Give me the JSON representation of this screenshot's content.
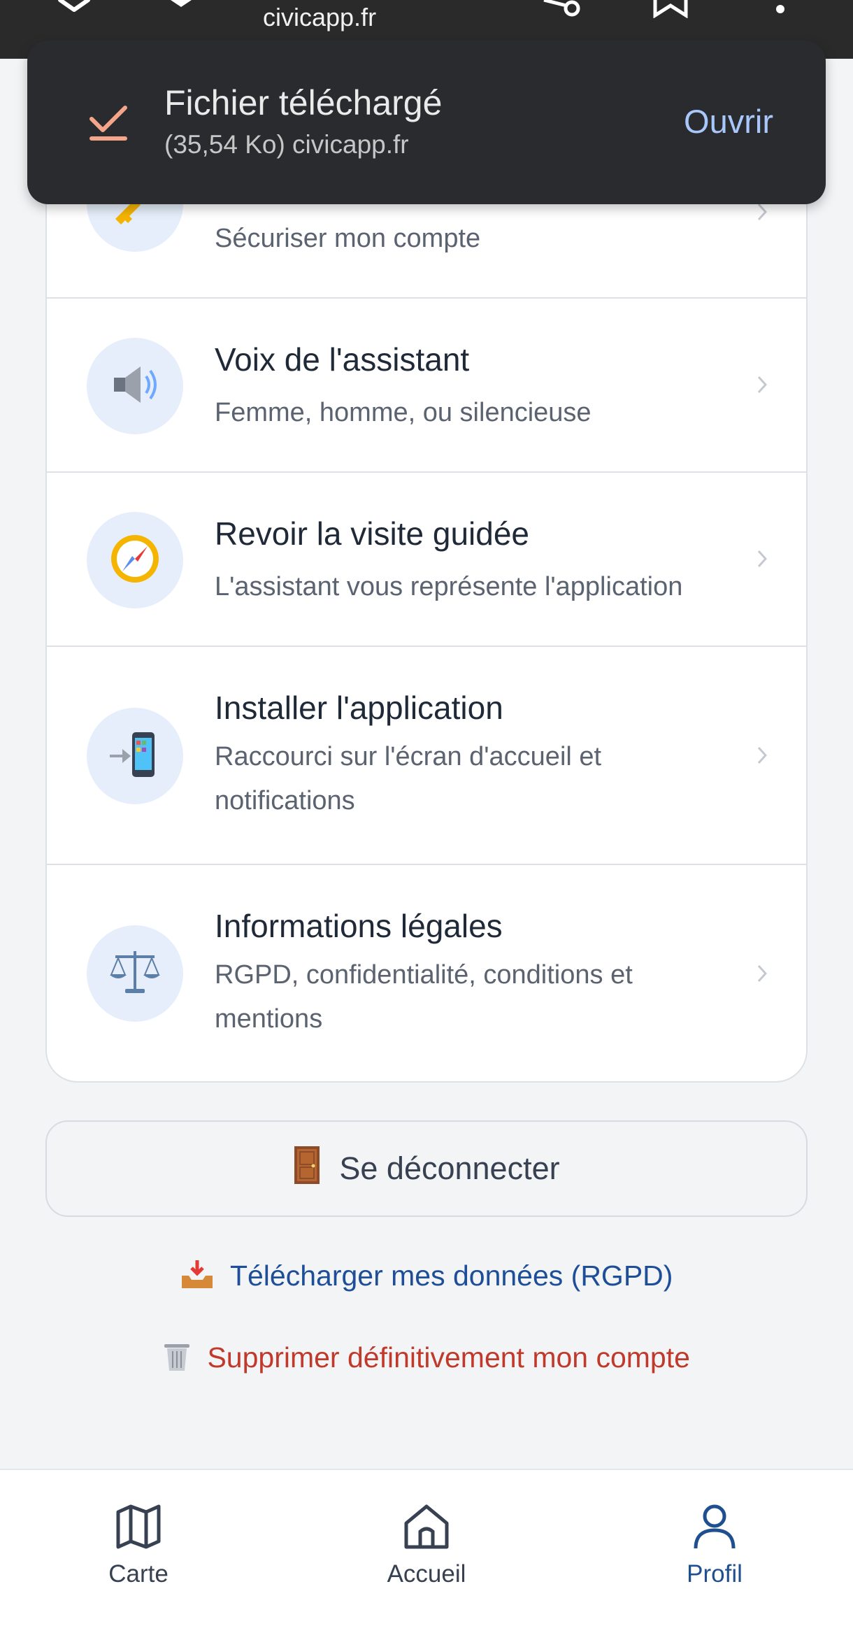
{
  "browser": {
    "url": "civicapp.fr",
    "icons": [
      "close-icon",
      "chevron-down-icon",
      "share-icon",
      "bookmark-icon",
      "more-vert-icon"
    ]
  },
  "toast": {
    "title": "Fichier téléchargé",
    "subtitle": "(35,54 Ko) civicapp.fr",
    "action": "Ouvrir",
    "icon": "download-done-icon"
  },
  "settings": {
    "items": [
      {
        "title": "",
        "subtitle": "Sécuriser mon compte",
        "icon": "key-icon"
      },
      {
        "title": "Voix de l'assistant",
        "subtitle": "Femme, homme, ou silencieuse",
        "icon": "speaker-icon"
      },
      {
        "title": "Revoir la visite guidée",
        "subtitle": "L'assistant vous représente l'application",
        "icon": "compass-icon"
      },
      {
        "title": "Installer l'application",
        "subtitle": "Raccourci sur l'écran d'accueil et notifications",
        "icon": "mobile-install-icon"
      },
      {
        "title": "Informations légales",
        "subtitle": "RGPD, confidentialité, conditions et mentions",
        "icon": "balance-scale-icon"
      }
    ]
  },
  "logout": {
    "label": "Se déconnecter",
    "icon": "door-icon"
  },
  "links": {
    "download_data": "Télécharger mes données (RGPD)",
    "delete_account": "Supprimer définitivement mon compte"
  },
  "nav": {
    "items": [
      {
        "label": "Carte",
        "icon": "map-icon"
      },
      {
        "label": "Accueil",
        "icon": "home-icon"
      },
      {
        "label": "Profil",
        "icon": "user-icon",
        "active": true
      }
    ]
  },
  "colors": {
    "accent": "#1e4f8f",
    "danger": "#c0392b",
    "toast_bg": "#2a2b2e",
    "toast_action": "#a8c7fa",
    "toast_check": "#f4a58a"
  }
}
